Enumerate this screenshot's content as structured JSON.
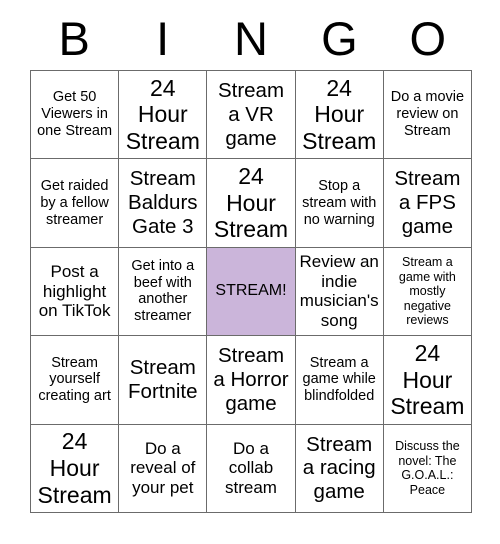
{
  "header": {
    "letters": [
      "B",
      "I",
      "N",
      "G",
      "O"
    ]
  },
  "grid": {
    "columns": 5,
    "rows": 5,
    "free_space_color": "#cbb5da",
    "border_color": "#6b6b6b",
    "cells": [
      {
        "text": "Get 50 Viewers in one Stream",
        "size": "sm",
        "free": false
      },
      {
        "text": "24 Hour Stream",
        "size": "xl",
        "free": false
      },
      {
        "text": "Stream a VR game",
        "size": "lg",
        "free": false
      },
      {
        "text": "24 Hour Stream",
        "size": "xl",
        "free": false
      },
      {
        "text": "Do a movie review on Stream",
        "size": "sm",
        "free": false
      },
      {
        "text": "Get raided by a fellow streamer",
        "size": "sm",
        "free": false
      },
      {
        "text": "Stream Baldurs Gate 3",
        "size": "lg",
        "free": false
      },
      {
        "text": "24 Hour Stream",
        "size": "xl",
        "free": false
      },
      {
        "text": "Stop a stream with no warning",
        "size": "sm",
        "free": false
      },
      {
        "text": "Stream a FPS game",
        "size": "lg",
        "free": false
      },
      {
        "text": "Post a highlight on TikTok",
        "size": "md",
        "free": false
      },
      {
        "text": "Get into a beef with another streamer",
        "size": "sm",
        "free": false
      },
      {
        "text": "STREAM!",
        "size": "md",
        "free": true
      },
      {
        "text": "Review an indie musician's song",
        "size": "md",
        "free": false
      },
      {
        "text": "Stream a game with mostly negative reviews",
        "size": "xs",
        "free": false
      },
      {
        "text": "Stream yourself creating art",
        "size": "sm",
        "free": false
      },
      {
        "text": "Stream Fortnite",
        "size": "lg",
        "free": false
      },
      {
        "text": "Stream a Horror game",
        "size": "lg",
        "free": false
      },
      {
        "text": "Stream a game while blindfolded",
        "size": "sm",
        "free": false
      },
      {
        "text": "24 Hour Stream",
        "size": "xl",
        "free": false
      },
      {
        "text": "24 Hour Stream",
        "size": "xl",
        "free": false
      },
      {
        "text": "Do a reveal of your pet",
        "size": "md",
        "free": false
      },
      {
        "text": "Do a collab stream",
        "size": "md",
        "free": false
      },
      {
        "text": "Stream a racing game",
        "size": "lg",
        "free": false
      },
      {
        "text": "Discuss the novel: The G.O.A.L.: Peace",
        "size": "xs",
        "free": false
      }
    ]
  }
}
